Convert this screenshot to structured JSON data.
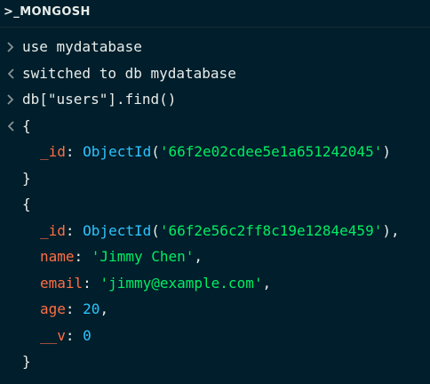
{
  "titlebar": {
    "prompt_glyph": ">_",
    "title": "MONGOSH"
  },
  "colors": {
    "background": "#001e2b",
    "text": "#e8edeb",
    "key": "#ff6f44",
    "function": "#2dc4ff",
    "string": "#00ed64",
    "number": "#2dc4ff",
    "marker": "#889397"
  },
  "console": {
    "input_icon": "chevron-right-icon",
    "output_icon": "chevron-left-icon",
    "cmd1": "use mydatabase",
    "out1": "switched to db mydatabase",
    "cmd2": "db[\"users\"].find()",
    "doc1": {
      "open": "{",
      "id_key": "_id",
      "id_fn": "ObjectId",
      "id_value": "'66f2e02cdee5e1a651242045'",
      "close": "}"
    },
    "doc2": {
      "open": "{",
      "id_key": "_id",
      "id_fn": "ObjectId",
      "id_value": "'66f2e56c2ff8c19e1284e459'",
      "name_key": "name",
      "name_value": "'Jimmy Chen'",
      "email_key": "email",
      "email_value": "'jimmy@example.com'",
      "age_key": "age",
      "age_value": "20",
      "v_key": "__v",
      "v_value": "0",
      "close": "}"
    }
  }
}
